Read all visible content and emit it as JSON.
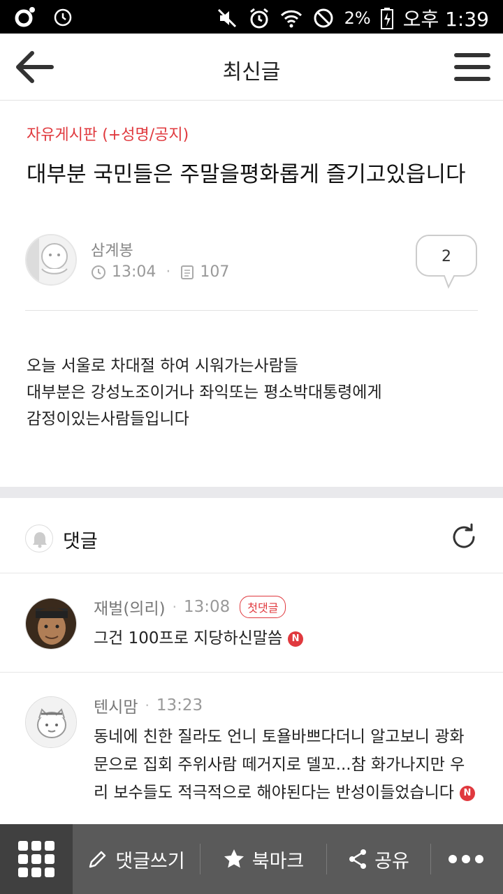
{
  "status_bar": {
    "battery": "2%",
    "time": "오후 1:39"
  },
  "app_bar": {
    "title": "최신글"
  },
  "article": {
    "category": "자유게시판 (+성명/공지)",
    "title": "대부분 국민들은 주말을평화롭게 즐기고있읍니다",
    "author": "삼계봉",
    "time": "13:04",
    "views": "107",
    "comment_count": "2",
    "body_lines": [
      "오늘 서울로 차대절 하여 시워가는사람들",
      "대부분은 강성노조이거나 좌익또는 평소박대통령에게",
      "감정이있는사람들입니다"
    ]
  },
  "comments": {
    "header": "댓글",
    "items": [
      {
        "author": "재벌(의리)",
        "time": "13:08",
        "badge": "첫댓글",
        "text": "그건 100프로 지당하신말씀",
        "new_mark": "N"
      },
      {
        "author": "텐시맘",
        "time": "13:23",
        "text": "동네에 친한 질라도 언니 토욜바쁘다더니 알고보니 광화문으로 집회 주위사람 떼거지로 델꼬...참 화가나지만 우리 보수들도 적극적으로 해야된다는 반성이들었습니다",
        "new_mark": "N"
      }
    ]
  },
  "bottom_bar": {
    "write_comment": "댓글쓰기",
    "bookmark": "북마크",
    "share": "공유"
  },
  "icons": {
    "back": "arrow-left-icon",
    "menu": "hamburger-menu-icon",
    "clock": "clock-icon",
    "views": "document-icon",
    "bell": "bell-icon",
    "refresh": "refresh-icon",
    "grid": "grid-icon",
    "pencil": "pencil-icon",
    "star": "star-icon",
    "share": "share-icon",
    "more": "more-dots-icon"
  },
  "colors": {
    "accent": "#e0393e",
    "bottom_bar": "#5a5a5a"
  }
}
